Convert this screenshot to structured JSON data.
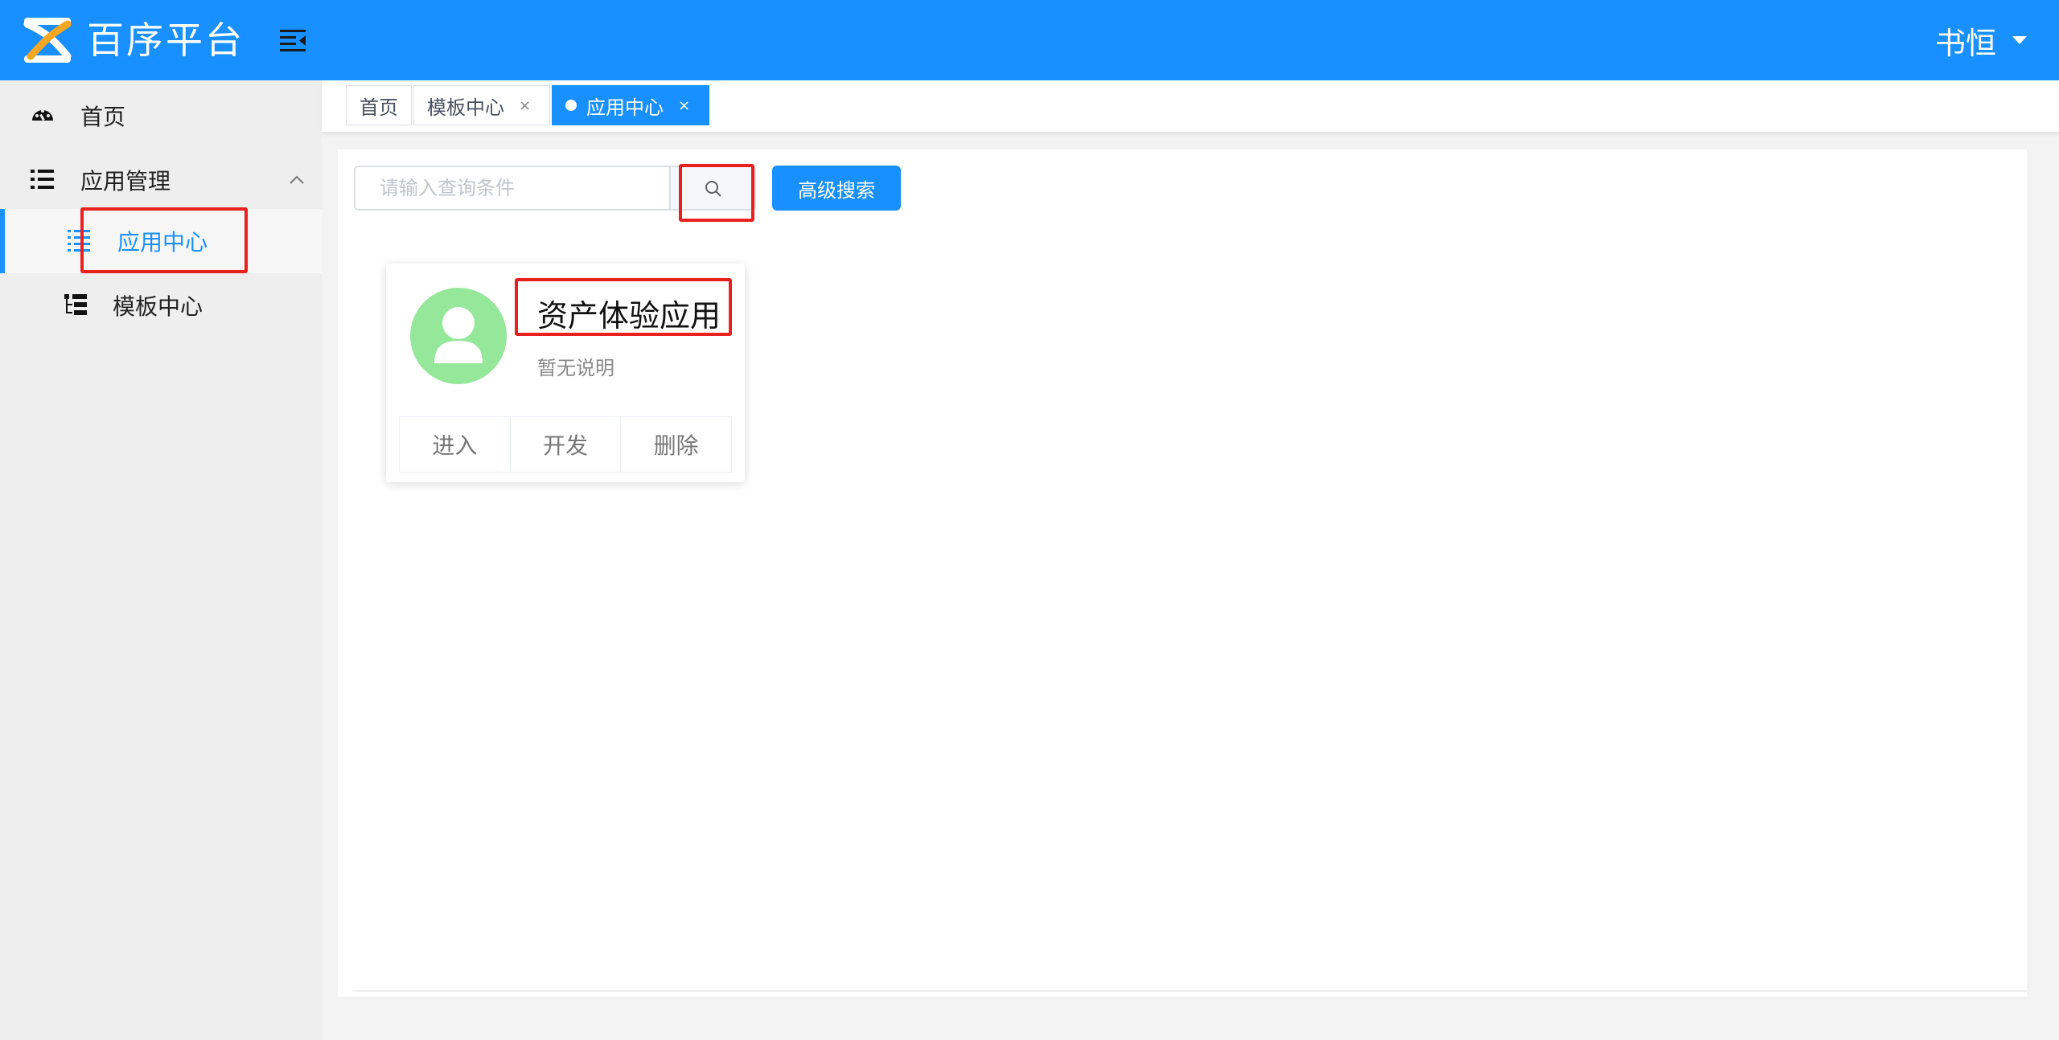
{
  "header": {
    "app_title": "百序平台",
    "user_name": "书恒",
    "logo_icon": "logo-icon",
    "menu_icon": "menu-fold-icon",
    "brand_color": "#1890ff"
  },
  "sidebar": {
    "items": [
      {
        "label": "首页",
        "icon": "dashboard-icon"
      },
      {
        "label": "应用管理",
        "icon": "list-icon",
        "expanded": true
      },
      {
        "label": "应用中心",
        "icon": "list-dots-icon",
        "active": true
      },
      {
        "label": "模板中心",
        "icon": "tree-table-icon"
      }
    ]
  },
  "tabs": [
    {
      "label": "首页"
    },
    {
      "label": "模板中心",
      "closable": true
    },
    {
      "label": "应用中心",
      "closable": true,
      "active": true
    }
  ],
  "search": {
    "placeholder": "请输入查询条件",
    "advanced_label": "高级搜索"
  },
  "card": {
    "title": "资产体验应用",
    "description": "暂无说明",
    "actions": [
      "进入",
      "开发",
      "删除"
    ]
  },
  "close_glyph": "×",
  "highlight_color": "#e8211f"
}
